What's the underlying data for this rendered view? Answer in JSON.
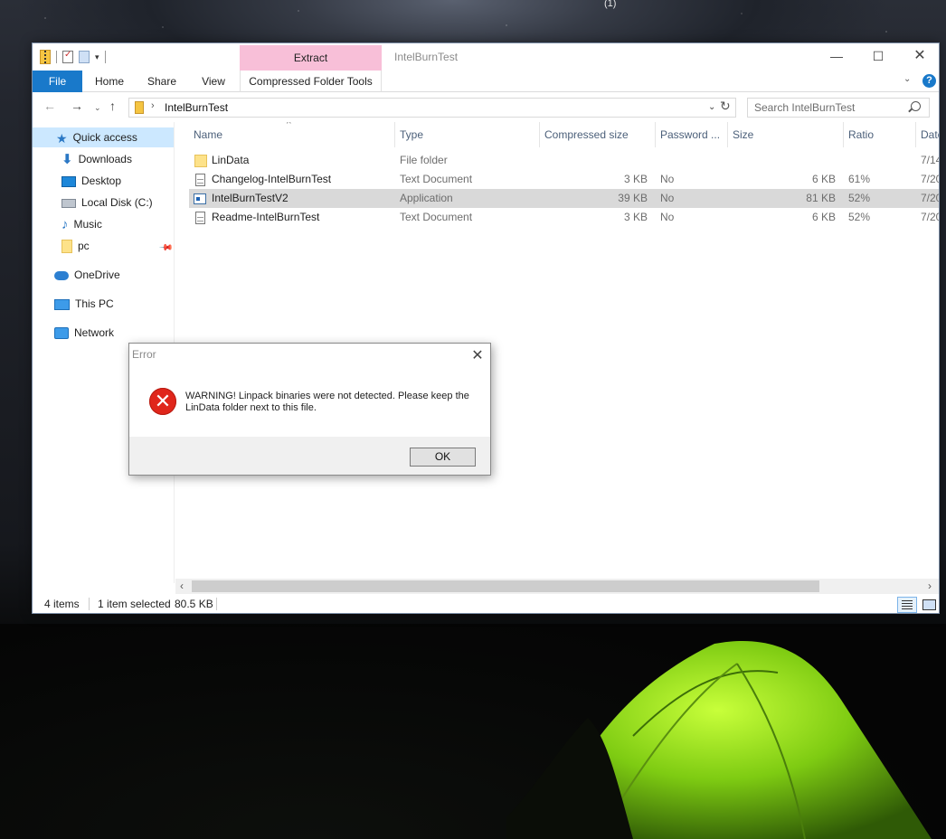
{
  "desktop": {
    "top_label": "(1)"
  },
  "window": {
    "title": "IntelBurnTest",
    "extract_tab": "Extract",
    "controls": {
      "minimize": "—",
      "maximize": "☐",
      "close": "✕"
    }
  },
  "ribbon": {
    "tabs": {
      "file": "File",
      "home": "Home",
      "share": "Share",
      "view": "View",
      "tools": "Compressed Folder Tools"
    },
    "help": "?"
  },
  "address": {
    "path": "IntelBurnTest",
    "search_placeholder": "Search IntelBurnTest"
  },
  "sidebar": {
    "items": [
      {
        "label": "Quick access"
      },
      {
        "label": "Downloads"
      },
      {
        "label": "Desktop"
      },
      {
        "label": "Local Disk (C:)"
      },
      {
        "label": "Music"
      },
      {
        "label": "pc"
      },
      {
        "label": "OneDrive"
      },
      {
        "label": "This PC"
      },
      {
        "label": "Network"
      }
    ]
  },
  "columns": {
    "name": "Name",
    "type": "Type",
    "compressed": "Compressed size",
    "password": "Password ...",
    "size": "Size",
    "ratio": "Ratio",
    "date": "Date"
  },
  "files": [
    {
      "name": "LinData",
      "type": "File folder",
      "compressed": "",
      "password": "",
      "size": "",
      "ratio": "",
      "date": "7/14"
    },
    {
      "name": "Changelog-IntelBurnTest",
      "type": "Text Document",
      "compressed": "3 KB",
      "password": "No",
      "size": "6 KB",
      "ratio": "61%",
      "date": "7/20"
    },
    {
      "name": "IntelBurnTestV2",
      "type": "Application",
      "compressed": "39 KB",
      "password": "No",
      "size": "81 KB",
      "ratio": "52%",
      "date": "7/20"
    },
    {
      "name": "Readme-IntelBurnTest",
      "type": "Text Document",
      "compressed": "3 KB",
      "password": "No",
      "size": "6 KB",
      "ratio": "52%",
      "date": "7/20"
    }
  ],
  "status": {
    "count": "4 items",
    "selection": "1 item selected",
    "size": "80.5 KB"
  },
  "dialog": {
    "title": "Error",
    "message": "WARNING! Linpack binaries were not detected. Please keep the LinData folder next to this file.",
    "ok": "OK"
  }
}
